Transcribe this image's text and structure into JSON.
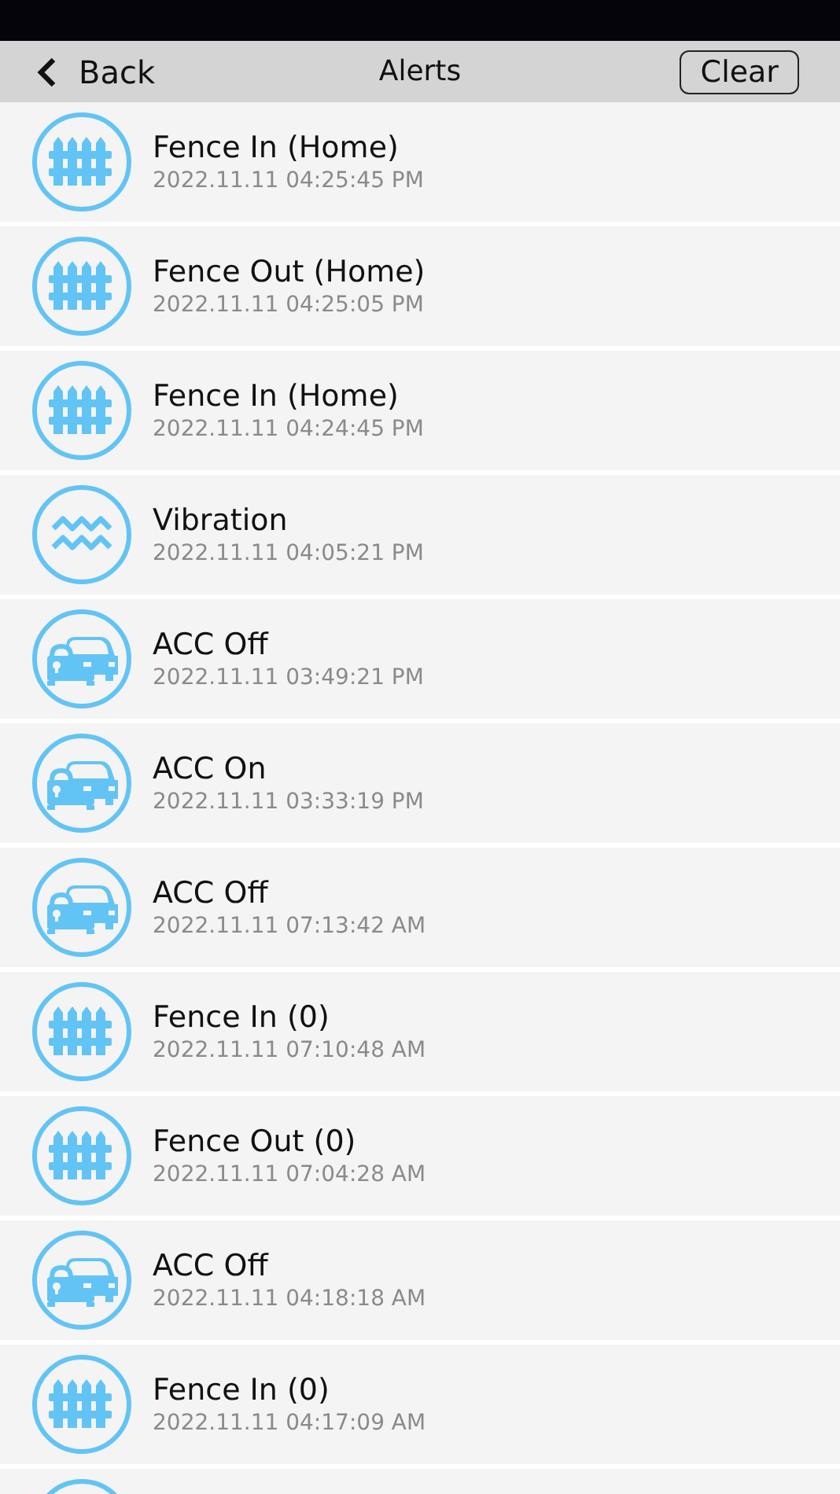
{
  "nav": {
    "back": "Back",
    "title": "Alerts",
    "clear": "Clear"
  },
  "alerts": [
    {
      "kind": "fence",
      "title": "Fence In (Home)",
      "time": "2022.11.11 04:25:45 PM"
    },
    {
      "kind": "fence",
      "title": "Fence Out (Home)",
      "time": "2022.11.11 04:25:05 PM"
    },
    {
      "kind": "fence",
      "title": "Fence In (Home)",
      "time": "2022.11.11 04:24:45 PM"
    },
    {
      "kind": "vibration",
      "title": "Vibration",
      "time": "2022.11.11 04:05:21 PM"
    },
    {
      "kind": "car",
      "title": "ACC Off",
      "time": "2022.11.11 03:49:21 PM"
    },
    {
      "kind": "car",
      "title": "ACC On",
      "time": "2022.11.11 03:33:19 PM"
    },
    {
      "kind": "car",
      "title": "ACC Off",
      "time": "2022.11.11 07:13:42 AM"
    },
    {
      "kind": "fence",
      "title": "Fence In (0)",
      "time": "2022.11.11 07:10:48 AM"
    },
    {
      "kind": "fence",
      "title": "Fence Out (0)",
      "time": "2022.11.11 07:04:28 AM"
    },
    {
      "kind": "car",
      "title": "ACC Off",
      "time": "2022.11.11 04:18:18 AM"
    },
    {
      "kind": "fence",
      "title": "Fence In (0)",
      "time": "2022.11.11 04:17:09 AM"
    },
    {
      "kind": "cut_off"
    }
  ]
}
